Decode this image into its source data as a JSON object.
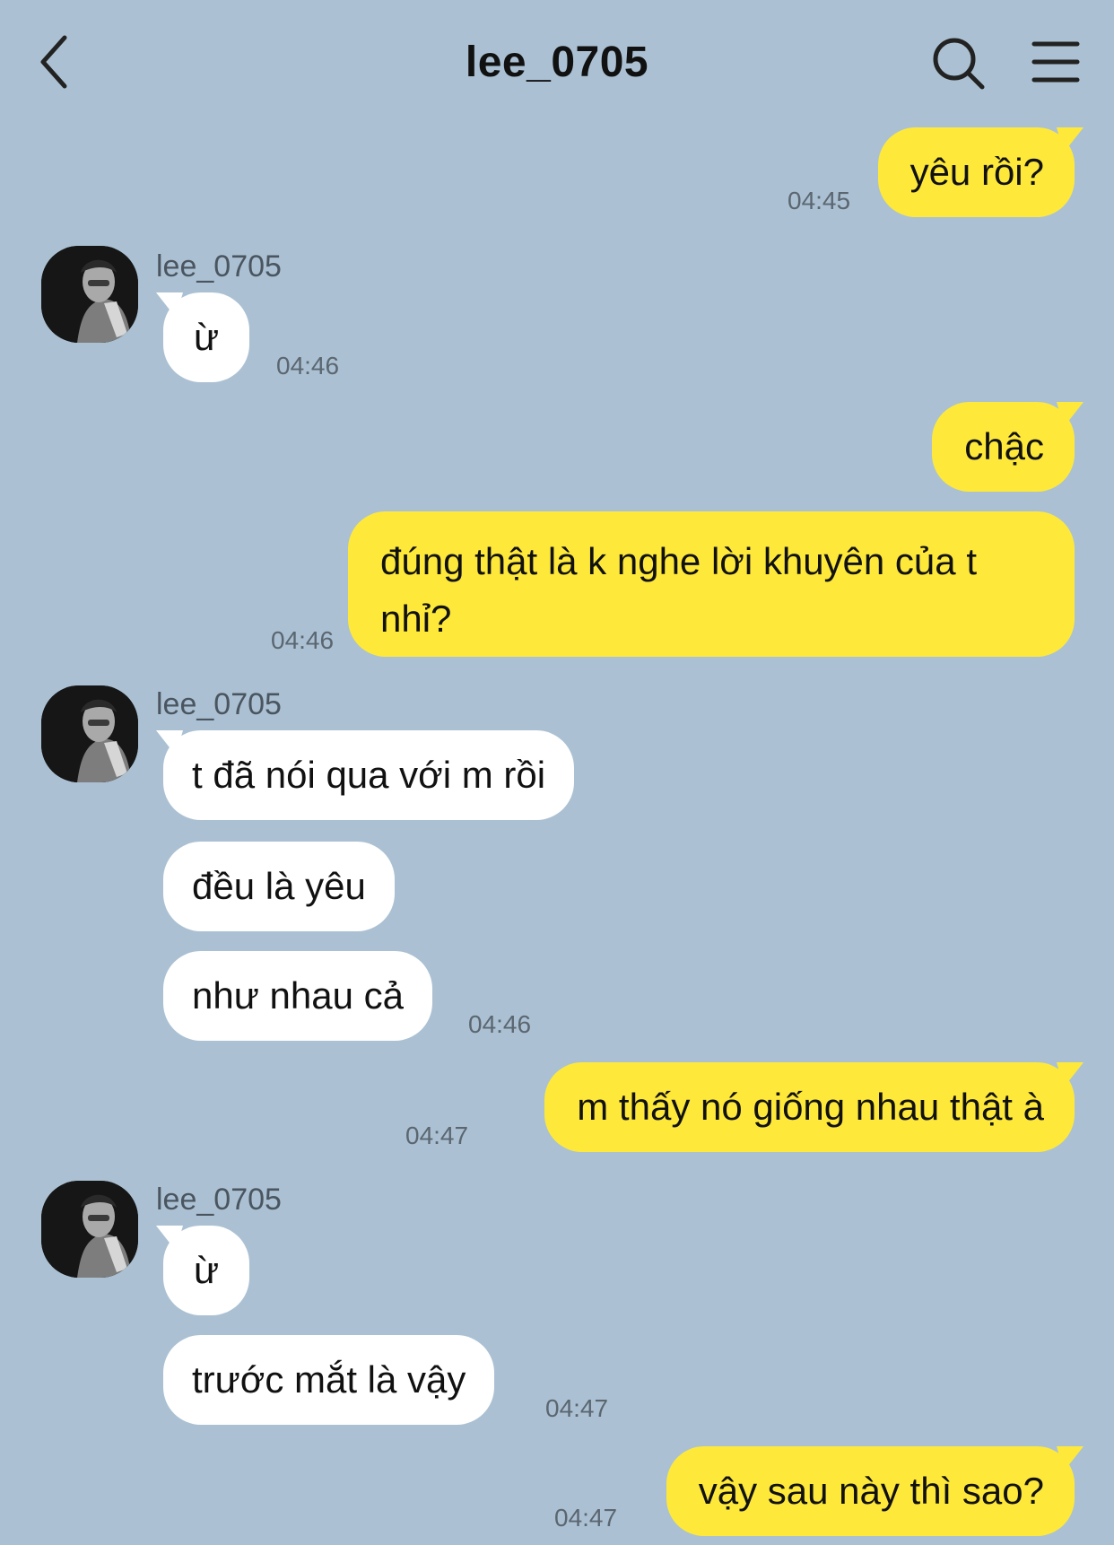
{
  "header": {
    "title": "lee_0705",
    "back_icon": "chevron-left-icon",
    "search_icon": "search-icon",
    "menu_icon": "hamburger-menu-icon"
  },
  "colors": {
    "background": "#abc1d3",
    "my_bubble": "#fee93a",
    "other_bubble": "#ffffff",
    "timestamp": "#5b6670"
  },
  "messages": [
    {
      "from": "me",
      "text": "yêu rồi?",
      "time": "04:45"
    },
    {
      "from": "lee_0705",
      "sender_name": "lee_0705",
      "text": "ừ",
      "time": "04:46"
    },
    {
      "from": "me",
      "text": "chậc",
      "time": ""
    },
    {
      "from": "me",
      "text": "đúng thật là k nghe lời khuyên của t nhỉ?",
      "time": "04:46"
    },
    {
      "from": "lee_0705",
      "sender_name": "lee_0705",
      "text": "t đã nói qua với m rồi",
      "time": ""
    },
    {
      "from": "lee_0705",
      "text": "đều là yêu",
      "time": ""
    },
    {
      "from": "lee_0705",
      "text": "như nhau cả",
      "time": "04:46"
    },
    {
      "from": "me",
      "text": "m thấy nó giống nhau thật à",
      "time": "04:47"
    },
    {
      "from": "lee_0705",
      "sender_name": "lee_0705",
      "text": "ừ",
      "time": ""
    },
    {
      "from": "lee_0705",
      "text": "trước mắt là vậy",
      "time": "04:47"
    },
    {
      "from": "me",
      "text": "vậy sau này thì sao?",
      "time": "04:47"
    }
  ]
}
